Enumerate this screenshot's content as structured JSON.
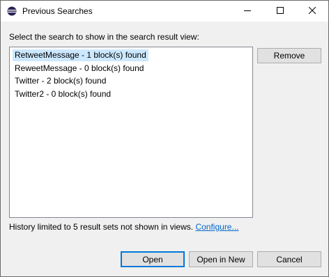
{
  "window": {
    "title": "Previous Searches",
    "app_icon": "eclipse-icon"
  },
  "titlebar_buttons": {
    "minimize": "minimize-icon",
    "maximize": "maximize-icon",
    "close": "close-icon"
  },
  "prompt": "Select the search to show in the search result view:",
  "searches": [
    {
      "label": "RetweetMessage - 1 block(s) found",
      "selected": true
    },
    {
      "label": "ReweetMessage - 0 block(s) found",
      "selected": false
    },
    {
      "label": "Twitter - 2 block(s) found",
      "selected": false
    },
    {
      "label": "Twitter2 - 0 block(s) found",
      "selected": false
    }
  ],
  "buttons": {
    "remove": "Remove",
    "open": "Open",
    "open_in_new": "Open in New",
    "cancel": "Cancel"
  },
  "history": {
    "text": "History limited to 5 result sets not shown in views.",
    "link": "Configure..."
  },
  "colors": {
    "selection": "#cce8ff",
    "link": "#0066cc",
    "default_button_border": "#0078d7"
  }
}
